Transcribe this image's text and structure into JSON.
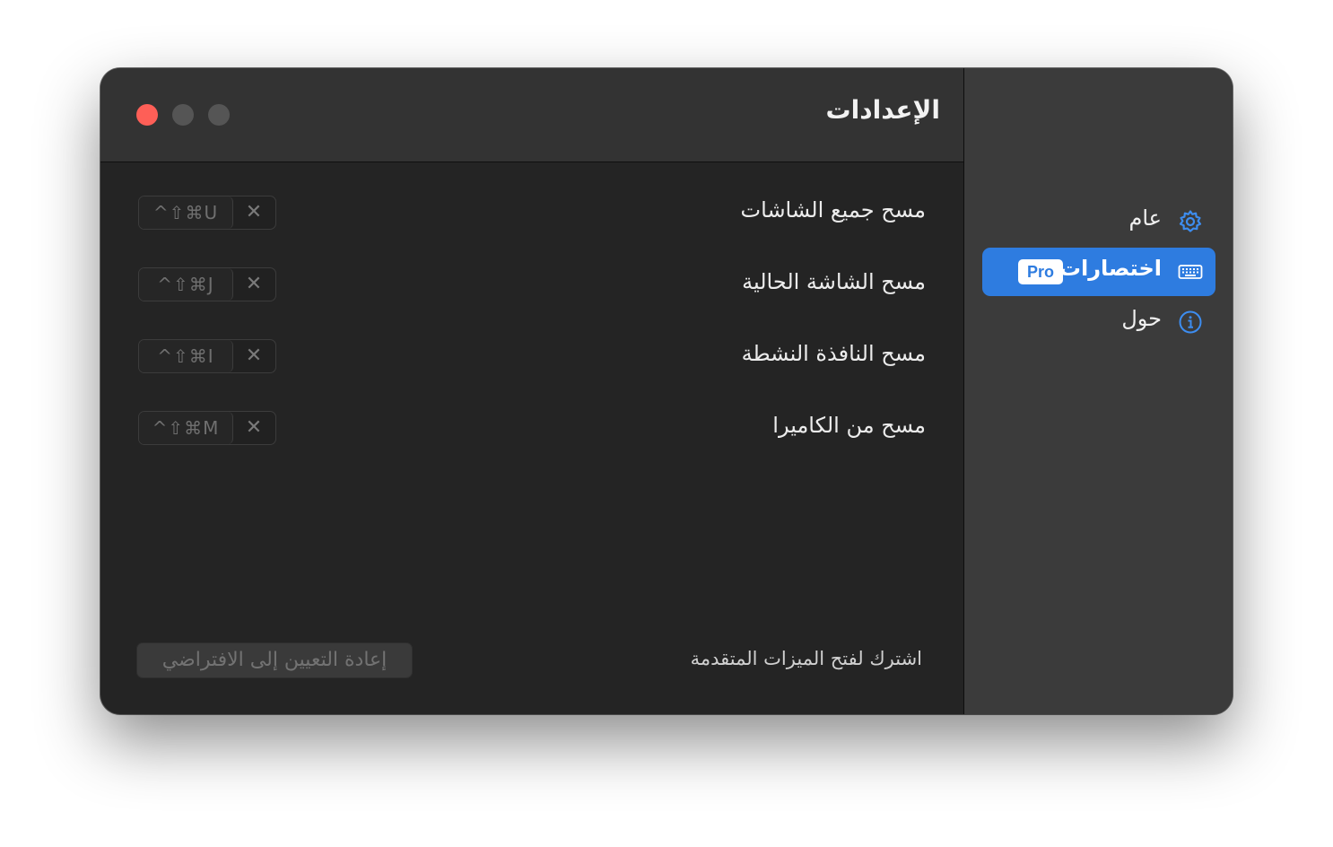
{
  "window": {
    "title": "الإعدادات"
  },
  "shortcuts": [
    {
      "label": "مسح جميع الشاشات",
      "keys": "^⇧⌘U",
      "clear": "✕"
    },
    {
      "label": "مسح الشاشة الحالية",
      "keys": "^⇧⌘J",
      "clear": "✕"
    },
    {
      "label": "مسح النافذة النشطة",
      "keys": "^⇧⌘I",
      "clear": "✕"
    },
    {
      "label": "مسح من الكاميرا",
      "keys": "^⇧⌘M",
      "clear": "✕"
    }
  ],
  "footer": {
    "subscribe_text": "اشترك لفتح الميزات المتقدمة",
    "reset_label": "إعادة التعيين إلى الافتراضي"
  },
  "sidebar": {
    "items": [
      {
        "label": "عام",
        "icon": "gear-icon",
        "active": false
      },
      {
        "label": "اختصارات",
        "icon": "keyboard-icon",
        "badge": "Pro",
        "active": true
      },
      {
        "label": "حول",
        "icon": "info-icon",
        "active": false
      }
    ]
  },
  "colors": {
    "accent": "#2e7ce0",
    "close": "#fe5f57",
    "window_bg": "#242424",
    "sidebar_bg": "#3b3b3b"
  }
}
